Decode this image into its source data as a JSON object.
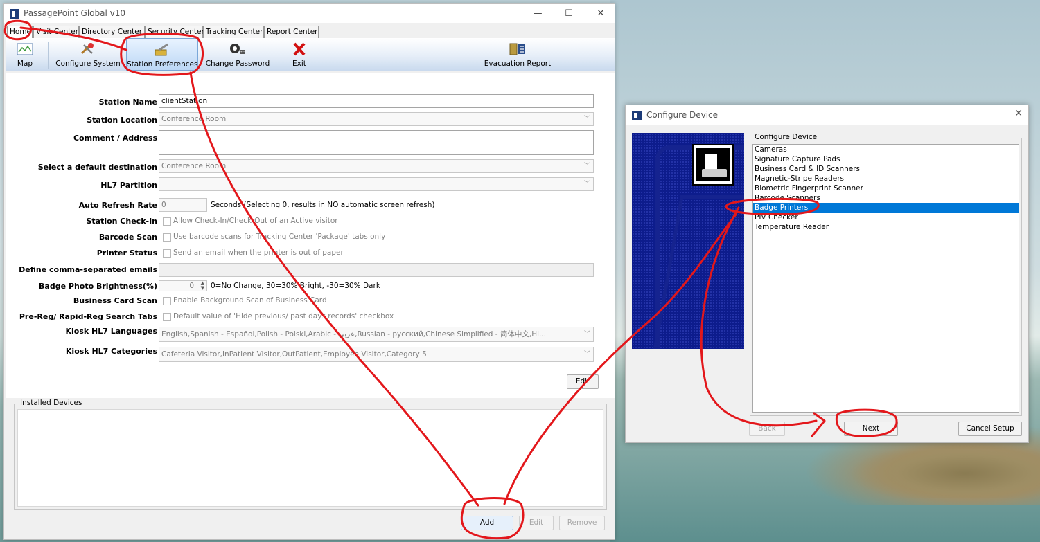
{
  "main_window": {
    "title": "PassagePoint Global v10",
    "controls": {
      "minimize": "—",
      "maximize": "☐",
      "close": "✕"
    },
    "tabs": [
      "Home",
      "Visit Center",
      "Directory Center",
      "Security Center",
      "Tracking Center",
      "Report Center"
    ],
    "ribbon": {
      "map": "Map",
      "configure_system": "Configure System",
      "station_preferences": "Station Preferences",
      "change_password": "Change Password",
      "exit": "Exit",
      "evacuation_report": "Evacuation Report"
    },
    "form": {
      "station_name_label": "Station Name",
      "station_name_value": "clientStation",
      "station_location_label": "Station Location",
      "station_location_value": "Conference Room",
      "comment_label": "Comment / Address",
      "default_destination_label": "Select a default destination",
      "default_destination_value": "Conference Room",
      "hl7_partition_label": "HL7 Partition",
      "auto_refresh_label": "Auto Refresh Rate",
      "auto_refresh_value": "0",
      "auto_refresh_note": "Seconds (Selecting 0, results in NO automatic screen refresh)",
      "station_checkin_label": "Station Check-In",
      "station_checkin_text": "Allow Check-In/Check-Out of an Active visitor",
      "barcode_scan_label": "Barcode Scan",
      "barcode_scan_text": "Use barcode scans for Tracking Center 'Package' tabs only",
      "printer_status_label": "Printer Status",
      "printer_status_text": "Send an email when the printer is out of paper",
      "emails_label": "Define comma-separated emails",
      "brightness_label": "Badge Photo Brightness(%)",
      "brightness_value": "0",
      "brightness_note": "0=No Change, 30=30% Bright, -30=30% Dark",
      "business_card_label": "Business Card Scan",
      "business_card_text": "Enable Background Scan of Business Card",
      "prereg_label": "Pre-Reg/ Rapid-Reg Search Tabs",
      "prereg_text": "Default value of 'Hide previous/ past days records' checkbox",
      "kiosk_lang_label": "Kiosk HL7 Languages",
      "kiosk_lang_value": "English,Spanish - Español,Polish - Polski,Arabic - عربي,Russian - русский,Chinese Simplified - 简体中文,Hi...",
      "kiosk_cat_label": "Kiosk HL7 Categories",
      "kiosk_cat_value": "Cafeteria Visitor,InPatient Visitor,OutPatient,Employee Visitor,Category 5",
      "edit_button": "Edit"
    },
    "installed_devices": {
      "title": "Installed Devices",
      "add_button": "Add",
      "edit_button": "Edit",
      "remove_button": "Remove"
    }
  },
  "dialog": {
    "title": "Configure Device",
    "close": "✕",
    "group_title": "Configure Device",
    "devices": [
      "Cameras",
      "Signature Capture Pads",
      "Business Card & ID Scanners",
      "Magnetic-Stripe Readers",
      "Biometric Fingerprint Scanner",
      "Barcode Scanners",
      "Badge Printers",
      "PIV Checker",
      "Temperature Reader"
    ],
    "selected_device": "Badge Printers",
    "back_button": "Back",
    "next_button": "Next",
    "cancel_button": "Cancel Setup"
  },
  "colors": {
    "annotation": "#e3171b",
    "selection": "#0078d7",
    "ribbon_selected": "#bcd7f5"
  }
}
